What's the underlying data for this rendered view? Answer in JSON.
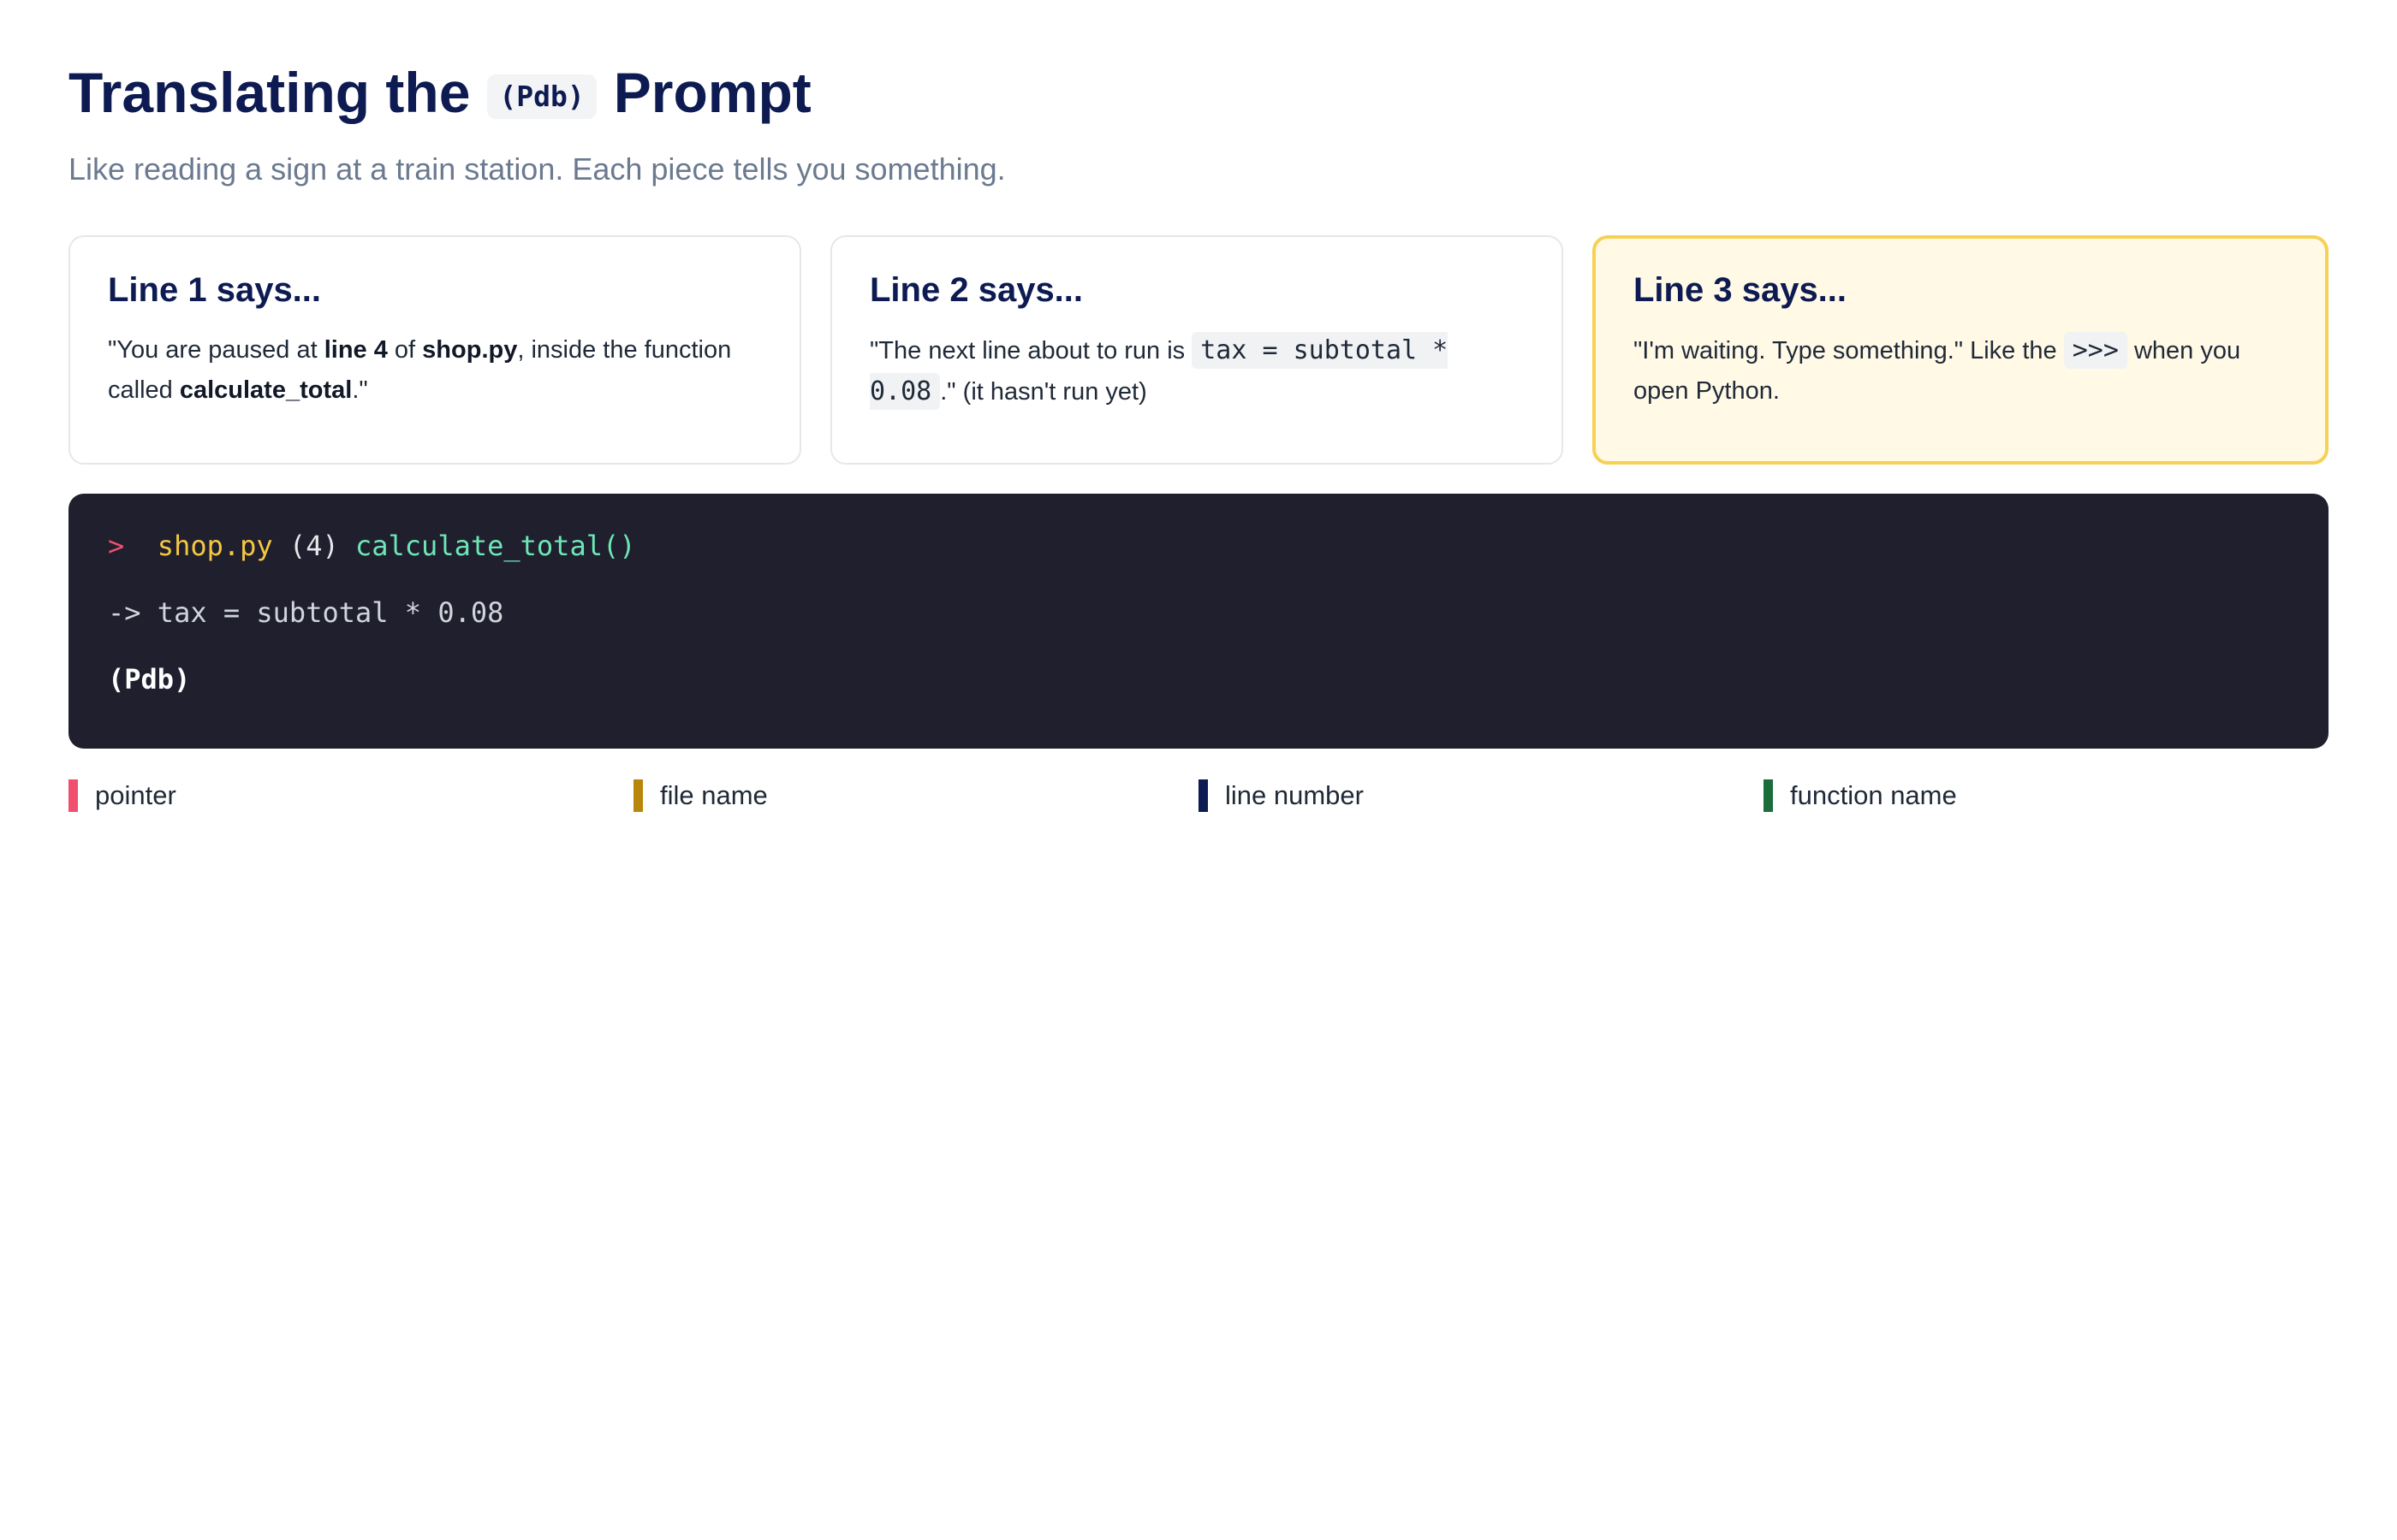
{
  "header": {
    "title_before": "Translating the",
    "title_code": "(Pdb)",
    "title_after": "Prompt",
    "subtitle": "Like reading a sign at a train station. Each piece tells you something."
  },
  "cards": [
    {
      "title": "Line 1 says...",
      "parts": [
        "\"You are paused at ",
        "line 4",
        " of ",
        "shop.py",
        ", inside the function called ",
        "calculate_total",
        ".\""
      ]
    },
    {
      "title": "Line 2 says...",
      "parts": [
        "\"The next line about to run is ",
        "tax = subtotal * 0.08",
        ".\" (it hasn't run yet)"
      ]
    },
    {
      "title": "Line 3 says...",
      "parts": [
        "\"I'm waiting. Type something.\" Like the ",
        ">>>",
        " when you open Python."
      ]
    }
  ],
  "terminal": {
    "pointer": ">",
    "file": "shop.py",
    "line_number": "(4)",
    "function": "calculate_total()",
    "next_line": "-> tax = subtotal * 0.08",
    "prompt": "(Pdb)"
  },
  "legend": [
    {
      "label": "pointer",
      "color": "#f0506e"
    },
    {
      "label": "file name",
      "color": "#b8860b"
    },
    {
      "label": "line number",
      "color": "#0d1b52"
    },
    {
      "label": "function name",
      "color": "#1b6e3a"
    }
  ],
  "colors": {
    "heading": "#0d1b52",
    "terminal_bg": "#1f1f2e",
    "highlight_border": "#f7d154",
    "highlight_bg": "#fff9e6"
  }
}
